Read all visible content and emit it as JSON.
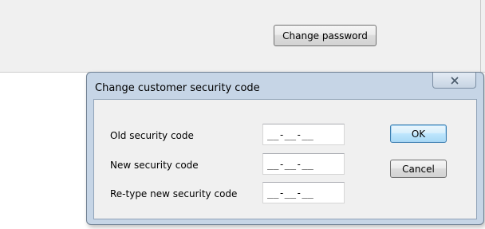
{
  "background": {
    "change_password_label": "Change password"
  },
  "dialog": {
    "title": "Change customer security code",
    "close_glyph": "✕",
    "fields": [
      {
        "label": "Old security code",
        "value": "__-__-__"
      },
      {
        "label": "New security code",
        "value": "__-__-__"
      },
      {
        "label": "Re-type new security code",
        "value": "__-__-__"
      }
    ],
    "ok_label": "OK",
    "cancel_label": "Cancel"
  },
  "colors": {
    "dialog_frame": "#c6d5e6",
    "client_area": "#f0f0f0",
    "focus_border": "#3c7fb1"
  }
}
